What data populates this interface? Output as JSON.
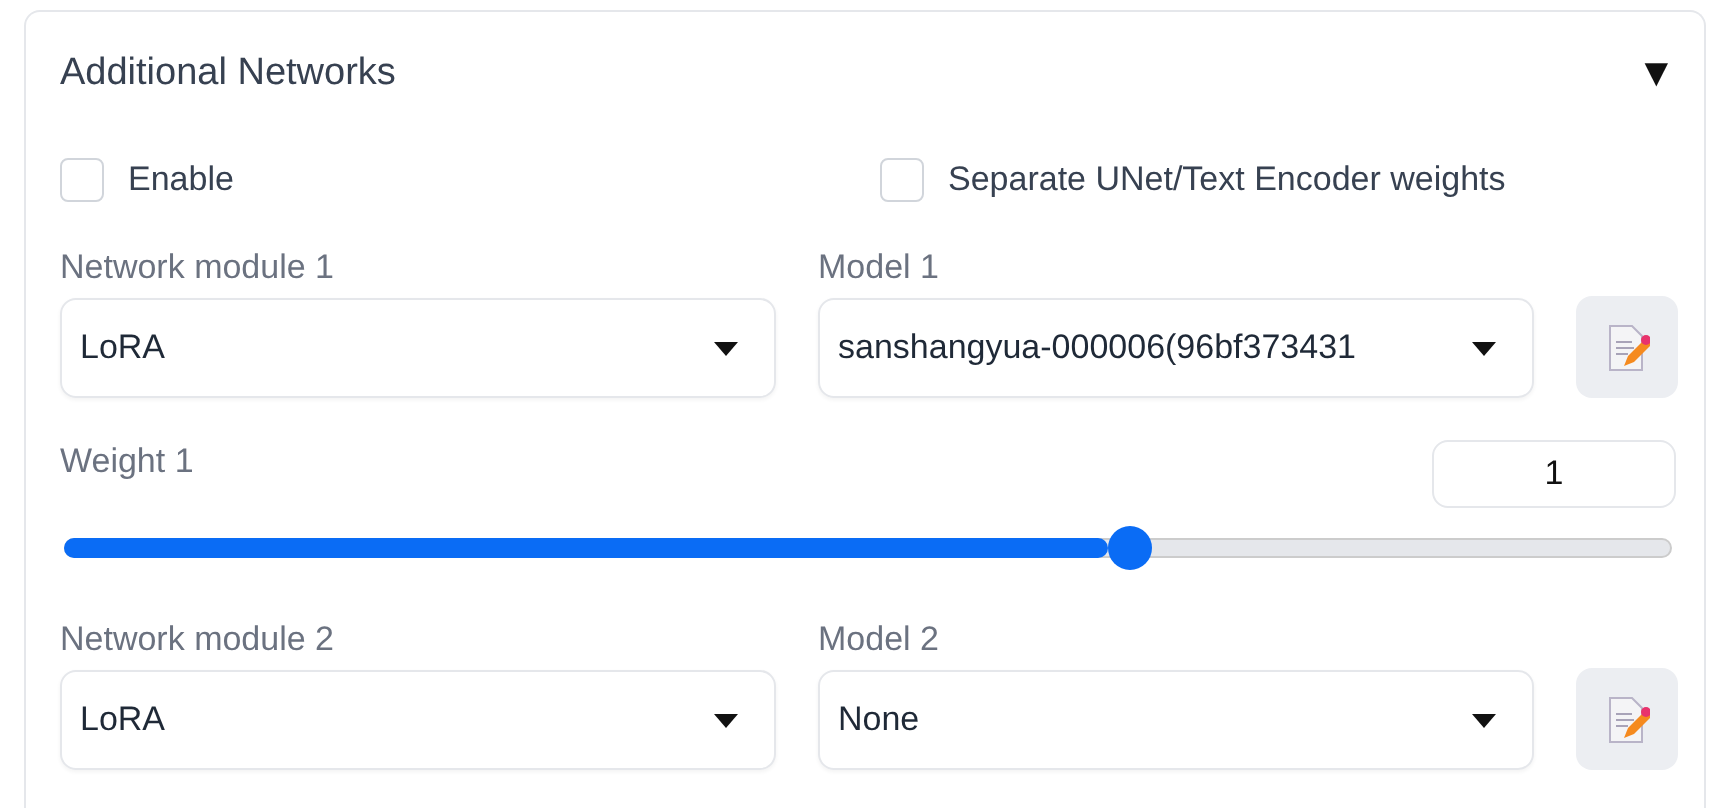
{
  "panel": {
    "title": "Additional Networks",
    "toggle": "▼"
  },
  "options": [
    {
      "label": "Enable",
      "checked": false
    },
    {
      "label": "Separate UNet/Text Encoder weights",
      "checked": false
    }
  ],
  "networks": [
    {
      "module_label": "Network module 1",
      "module": "LoRA",
      "model_label": "Model 1",
      "model": "sanshangyua-000006(96bf373431",
      "weight_label": "Weight 1",
      "weight": "1",
      "level": 0.663
    },
    {
      "module_label": "Network module 2",
      "module": "LoRA",
      "model_label": "Model 2",
      "model": "None"
    }
  ]
}
